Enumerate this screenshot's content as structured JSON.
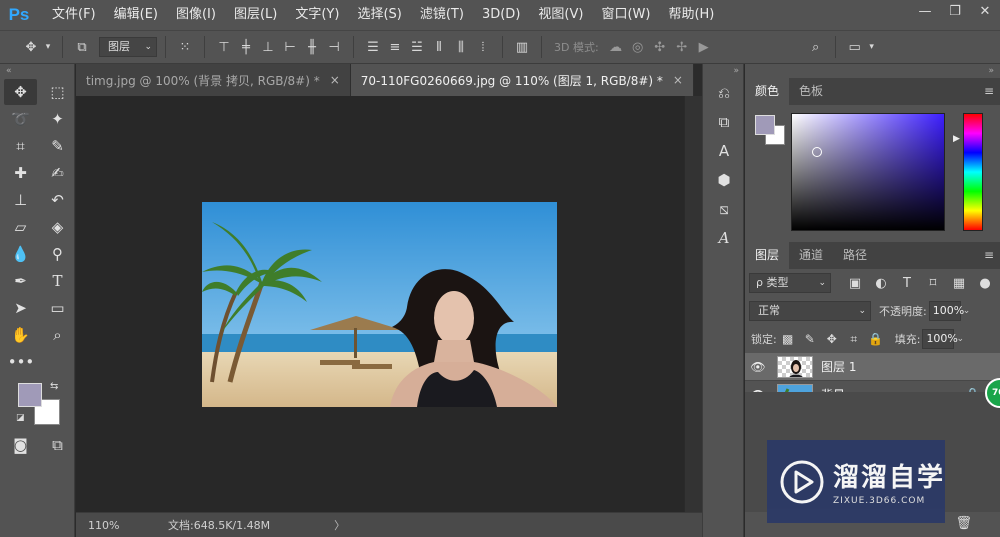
{
  "app": {
    "logo": "Ps"
  },
  "menu": [
    "文件(F)",
    "编辑(E)",
    "图像(I)",
    "图层(L)",
    "文字(Y)",
    "选择(S)",
    "滤镜(T)",
    "3D(D)",
    "视图(V)",
    "窗口(W)",
    "帮助(H)"
  ],
  "window_controls": {
    "minimize": "—",
    "restore": "❐",
    "close": "✕"
  },
  "options_bar": {
    "auto_select_target": "图层",
    "mode_3d_label": "3D 模式:"
  },
  "tabs": [
    {
      "title": "timg.jpg @ 100% (背景 拷贝, RGB/8#) *",
      "close": "×",
      "active": false
    },
    {
      "title": "70-110FG0260669.jpg @ 110% (图层 1, RGB/8#) *",
      "close": "×",
      "active": true
    }
  ],
  "status": {
    "zoom": "110%",
    "doc_size": "文档:648.5K/1.48M",
    "arrow": "〉"
  },
  "color_panel": {
    "tabs": [
      "颜色",
      "色板"
    ],
    "foreground": "#a09ab8",
    "background": "#ffffff",
    "hue_color": "#3d1fff"
  },
  "layers_panel": {
    "tabs": [
      "图层",
      "通道",
      "路径"
    ],
    "kind_filter": "ρ 类型",
    "blend_mode": "正常",
    "opacity_label": "不透明度:",
    "opacity": "100%",
    "lock_label": "锁定:",
    "fill_label": "填充:",
    "fill": "100%",
    "layers": [
      {
        "name": "图层 1",
        "selected": true
      },
      {
        "name": "背景",
        "selected": false,
        "locked": true
      }
    ]
  },
  "watermark": {
    "title": "溜溜自学",
    "subtitle": "ZIXUE.3D66.COM",
    "badge": "70"
  },
  "colors": {
    "ui_bg": "#535353",
    "canvas_bg": "#282828",
    "accent": "#31a8ff"
  }
}
